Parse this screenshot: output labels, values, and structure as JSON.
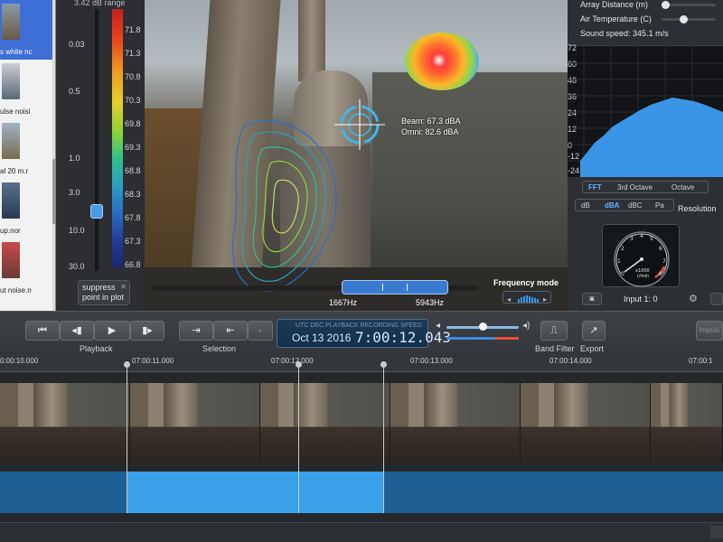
{
  "file_strip": {
    "items": [
      {
        "label": "s white nc",
        "selected": true
      },
      {
        "label": "ulse noisi",
        "selected": false
      },
      {
        "label": "al 20 m.r",
        "selected": false
      },
      {
        "label": "up.nor",
        "selected": false
      },
      {
        "label": "ut noise.n",
        "selected": false
      }
    ]
  },
  "level_panel": {
    "range_title": "3.42 dB range",
    "slider_ticks": [
      "0.03",
      "0.5",
      "1.0",
      "3.0",
      "10.0",
      "30.0"
    ],
    "colorbar_ticks": [
      "71.8",
      "71.3",
      "70.8",
      "70.3",
      "69.8",
      "69.3",
      "68.8",
      "68.3",
      "67.8",
      "67.3",
      "66.8"
    ],
    "suppress_label": "suppress point in plot",
    "colors": {
      "hot": "#c81e1e",
      "cold": "#1a2870"
    }
  },
  "video": {
    "beam_label": "Beam: 67.3 dBA",
    "omni_label": "Omni: 82.6 dBA",
    "freq_low": "1667Hz",
    "freq_high": "5943Hz",
    "freq_mode": "Frequency mode"
  },
  "right_panel": {
    "array_distance": "Array Distance (m)",
    "air_temperature": "Air Temperature (C)",
    "sound_speed": "Sound speed:  345.1 m/s",
    "spectrum_ticks": [
      "72",
      "60",
      "48",
      "36",
      "24",
      "12",
      "0",
      "-12",
      "-24"
    ],
    "analysis_tabs": [
      {
        "label": "FFT",
        "active": true
      },
      {
        "label": "3rd Octave",
        "active": false
      },
      {
        "label": "Octave",
        "active": false
      }
    ],
    "weighting_tabs": [
      {
        "label": "dB",
        "active": false
      },
      {
        "label": "dBA",
        "active": true
      },
      {
        "label": "dBC",
        "active": false
      },
      {
        "label": "Pa",
        "active": false
      }
    ],
    "resolution_label": "Resolution",
    "input_label": "Input 1: 0",
    "gauge_unit": "r/min",
    "gauge_scale": "x1000",
    "accent": "#3b95e6"
  },
  "toolbar": {
    "playback_caption": "Playback",
    "selection_caption": "Selection",
    "band_filter_caption": "Band Filter",
    "export_caption": "Export",
    "lcd_header": "UTC  DEC  PLAYBACK  RECORDING  SPEED",
    "lcd_date": "Oct 13 2016",
    "lcd_time": "7:00:12.043",
    "impulse_label": "Impuls"
  },
  "timeline": {
    "ruler": [
      "0:00:10.000",
      "07:00:11.000",
      "07:00:12.000",
      "07:00:13.000",
      "07:00:14.000",
      "07:00:1"
    ]
  }
}
